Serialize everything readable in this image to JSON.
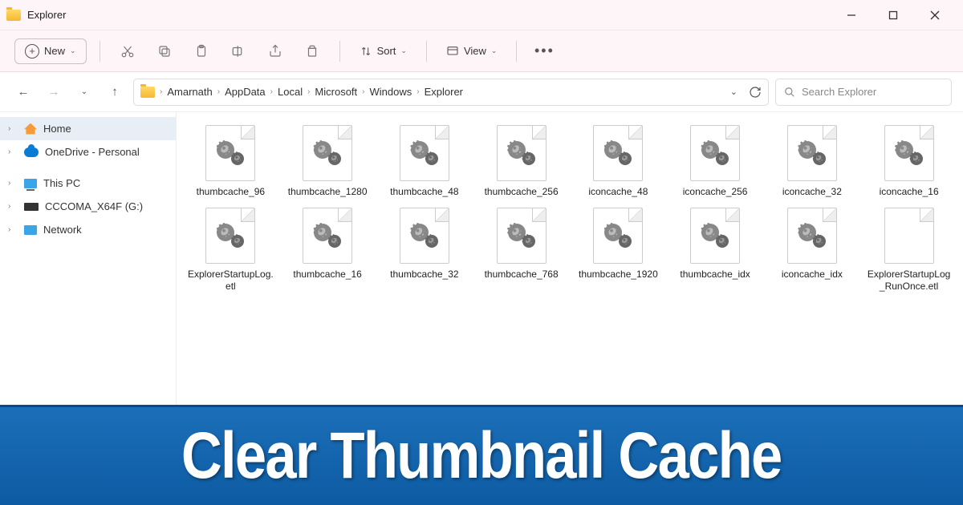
{
  "window": {
    "title": "Explorer"
  },
  "toolbar": {
    "new_label": "New",
    "sort_label": "Sort",
    "view_label": "View"
  },
  "breadcrumbs": [
    "Amarnath",
    "AppData",
    "Local",
    "Microsoft",
    "Windows",
    "Explorer"
  ],
  "search": {
    "placeholder": "Search Explorer"
  },
  "sidebar": {
    "items": [
      {
        "label": "Home"
      },
      {
        "label": "OneDrive - Personal"
      },
      {
        "label": "This PC"
      },
      {
        "label": "CCCOMA_X64F (G:)"
      },
      {
        "label": "Network"
      }
    ]
  },
  "files": [
    {
      "label": "thumbcache_96",
      "type": "gear"
    },
    {
      "label": "thumbcache_1280",
      "type": "gear"
    },
    {
      "label": "thumbcache_48",
      "type": "gear"
    },
    {
      "label": "thumbcache_256",
      "type": "gear"
    },
    {
      "label": "iconcache_48",
      "type": "gear"
    },
    {
      "label": "iconcache_256",
      "type": "gear"
    },
    {
      "label": "iconcache_32",
      "type": "gear"
    },
    {
      "label": "iconcache_16",
      "type": "gear"
    },
    {
      "label": "ExplorerStartupLog.etl",
      "type": "gear"
    },
    {
      "label": "thumbcache_16",
      "type": "gear"
    },
    {
      "label": "thumbcache_32",
      "type": "gear"
    },
    {
      "label": "thumbcache_768",
      "type": "gear"
    },
    {
      "label": "thumbcache_1920",
      "type": "gear"
    },
    {
      "label": "thumbcache_idx",
      "type": "gear"
    },
    {
      "label": "iconcache_idx",
      "type": "gear"
    },
    {
      "label": "ExplorerStartupLog_RunOnce.etl",
      "type": "blank"
    }
  ],
  "banner": {
    "text": "Clear Thumbnail Cache"
  }
}
